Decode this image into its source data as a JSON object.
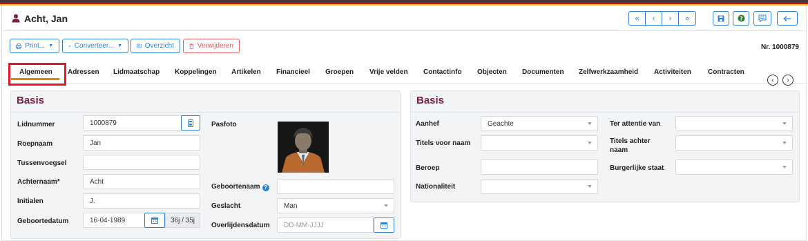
{
  "window": {
    "title": "Acht, Jan"
  },
  "nav_buttons": {
    "first": "«",
    "prev": "‹",
    "next": "›",
    "last": "»"
  },
  "toolbar": {
    "print_label": "Print...",
    "convert_label": "Converteer...",
    "overview_label": "Overzicht",
    "delete_label": "Verwijderen",
    "member_number": "Nr. 1000879"
  },
  "tabs": [
    {
      "label": "Algemeen",
      "active": true
    },
    {
      "label": "Adressen"
    },
    {
      "label": "Lidmaatschap"
    },
    {
      "label": "Koppelingen"
    },
    {
      "label": "Artikelen"
    },
    {
      "label": "Financieel"
    },
    {
      "label": "Groepen"
    },
    {
      "label": "Vrije velden"
    },
    {
      "label": "Contactinfo"
    },
    {
      "label": "Objecten"
    },
    {
      "label": "Documenten"
    },
    {
      "label": "Zelfwerkzaamheid"
    },
    {
      "label": "Activiteiten"
    },
    {
      "label": "Contracten"
    }
  ],
  "left_panel": {
    "title": "Basis",
    "lidnummer": {
      "label": "Lidnummer",
      "value": "1000879"
    },
    "roepnaam": {
      "label": "Roepnaam",
      "value": "Jan"
    },
    "tussenvoegsel": {
      "label": "Tussenvoegsel",
      "value": ""
    },
    "achternaam": {
      "label": "Achternaam*",
      "value": "Acht"
    },
    "initialen": {
      "label": "Initialen",
      "value": "J."
    },
    "geboortedatum": {
      "label": "Geboortedatum",
      "value": "16-04-1989",
      "age": "36j / 35j"
    },
    "pasfoto": {
      "label": "Pasfoto"
    },
    "geboortenaam": {
      "label": "Geboortenaam",
      "value": ""
    },
    "geslacht": {
      "label": "Geslacht",
      "value": "Man"
    },
    "overlijdensdatum": {
      "label": "Overlijdensdatum",
      "placeholder": "DD-MM-JJJJ"
    }
  },
  "right_panel": {
    "title": "Basis",
    "aanhef": {
      "label": "Aanhef",
      "value": "Geachte"
    },
    "titels_voor": {
      "label": "Titels voor naam",
      "value": ""
    },
    "beroep": {
      "label": "Beroep",
      "value": ""
    },
    "nationaliteit": {
      "label": "Nationaliteit",
      "value": ""
    },
    "ter_attentie": {
      "label": "Ter attentie van",
      "value": ""
    },
    "titels_achter": {
      "label": "Titels achter naam",
      "value": ""
    },
    "burgerlijke_staat": {
      "label": "Burgerlijke staat",
      "value": ""
    }
  },
  "colors": {
    "accent": "#2f80d1",
    "danger": "#e05a5a",
    "panel_title": "#7b1e45",
    "active_tab": "#e08a00",
    "highlight": "#e01b24"
  }
}
